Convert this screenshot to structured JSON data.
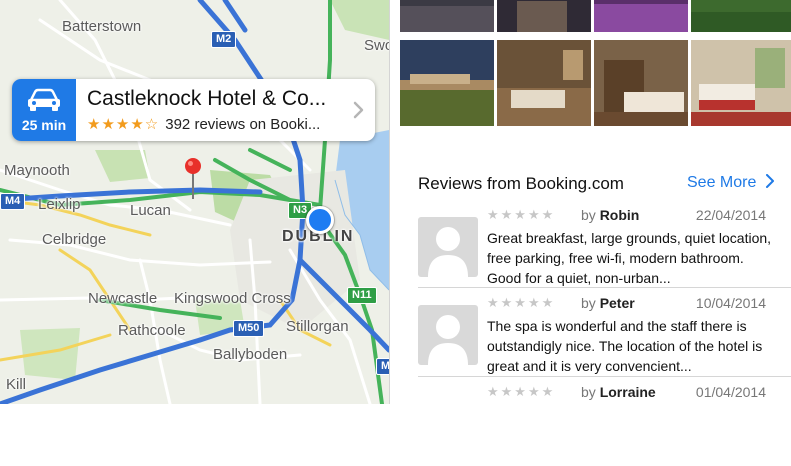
{
  "map": {
    "places": {
      "batterstown": "Batterstown",
      "maynooth": "Maynooth",
      "leixlip": "Leixlip",
      "lucan": "Lucan",
      "celbridge": "Celbridge",
      "newcastle": "Newcastle",
      "kingswood_cross": "Kingswood Cross",
      "rathcoole": "Rathcoole",
      "ballyboden": "Ballyboden",
      "stillorgan": "Stillorgan",
      "dublin": "DUBLIN",
      "swords_partial": "Swo",
      "kill_partial": "Kill"
    },
    "shields": {
      "m2": "M2",
      "m4": "M4",
      "m50": "M50",
      "n3": "N3",
      "n11": "N11",
      "m11_partial": "M"
    }
  },
  "callout": {
    "eta": "25 min",
    "title": "Castleknock Hotel & Co...",
    "stars": "★★★★☆",
    "reviews": "392 reviews on Booki..."
  },
  "reviews_section": {
    "heading": "Reviews from Booking.com",
    "see_more": "See More",
    "items": [
      {
        "stars": "★★★★★",
        "by_prefix": "by",
        "author": "Robin",
        "date": "22/04/2014",
        "text": "Great breakfast, large grounds, quiet location, free parking, free wi-fi, modern bathroom. Good for a quiet, non-urban..."
      },
      {
        "stars": "★★★★★",
        "by_prefix": "by",
        "author": "Peter",
        "date": "10/04/2014",
        "text": "The spa is wonderful and the staff there is outstandigly nice. The location of the hotel is great and it is very convencient..."
      },
      {
        "stars": "★★★★★",
        "by_prefix": "by",
        "author": "Lorraine",
        "date": "01/04/2014",
        "text": ""
      }
    ]
  },
  "colors": {
    "accent": "#1f7ae6",
    "star_filled": "#f29b1d",
    "star_empty": "#c7c7c7",
    "pin": "#e8302a",
    "motorway": "#2a5fb4",
    "national_road": "#2f9e46"
  }
}
